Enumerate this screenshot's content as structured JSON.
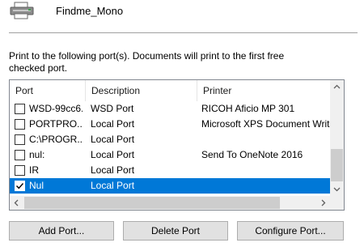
{
  "header": {
    "printer_name": "Findme_Mono",
    "icon": "printer-icon"
  },
  "instruction": {
    "text": "Print to the following port(s). Documents will print to the first free checked port."
  },
  "port_list": {
    "columns": {
      "port": "Port",
      "description": "Description",
      "printer": "Printer"
    },
    "rows": [
      {
        "checked": false,
        "selected": false,
        "port": "WSD-99cc6...",
        "description": "WSD Port",
        "printer": "RICOH Aficio MP 301"
      },
      {
        "checked": false,
        "selected": false,
        "port": "PORTPRO...",
        "description": "Local Port",
        "printer": "Microsoft XPS Document Writ"
      },
      {
        "checked": false,
        "selected": false,
        "port": "C:\\PROGR...",
        "description": "Local Port",
        "printer": ""
      },
      {
        "checked": false,
        "selected": false,
        "port": "nul:",
        "description": "Local Port",
        "printer": "Send To OneNote 2016"
      },
      {
        "checked": false,
        "selected": false,
        "port": "IR",
        "description": "Local Port",
        "printer": ""
      },
      {
        "checked": true,
        "selected": true,
        "port": "Nul",
        "description": "Local Port",
        "printer": ""
      }
    ],
    "selection_color": "#0078d7"
  },
  "buttons": {
    "add_port": "Add Port...",
    "delete_port": "Delete Port",
    "configure_port": "Configure Port..."
  }
}
